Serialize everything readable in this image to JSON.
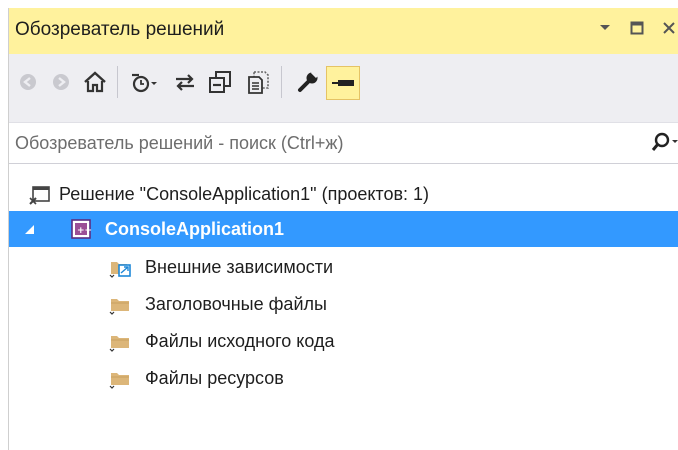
{
  "panel": {
    "title": "Обозреватель решений"
  },
  "window_buttons": {
    "dropdown_icon": "chevron-down-icon",
    "maximize_icon": "maximize-icon",
    "close_icon": "close-icon"
  },
  "toolbar": {
    "buttons": [
      {
        "name": "back",
        "icon": "back-arrow-icon"
      },
      {
        "name": "forward",
        "icon": "forward-arrow-icon"
      },
      {
        "name": "home",
        "icon": "home-icon"
      },
      {
        "name": "pending-changes",
        "icon": "clock-icon"
      },
      {
        "name": "sync",
        "icon": "sync-arrows-icon"
      },
      {
        "name": "collapse-all",
        "icon": "collapse-all-icon"
      },
      {
        "name": "show-all-files",
        "icon": "show-all-files-icon"
      },
      {
        "name": "properties",
        "icon": "wrench-icon"
      },
      {
        "name": "preview",
        "icon": "preview-pin-icon"
      }
    ]
  },
  "search": {
    "placeholder": "Обозреватель решений - поиск (Ctrl+ж)",
    "icon": "search-icon"
  },
  "tree": {
    "solution": {
      "label": "Решение \"ConsoleApplication1\"  (проектов: 1)",
      "icon": "solution-icon"
    },
    "project": {
      "label": "ConsoleApplication1",
      "icon": "cpp-project-icon",
      "selected": true,
      "expanded": true
    },
    "folders": [
      {
        "label": "Внешние зависимости",
        "icon": "external-dependencies-icon"
      },
      {
        "label": "Заголовочные файлы",
        "icon": "folder-filter-icon"
      },
      {
        "label": "Файлы исходного кода",
        "icon": "folder-filter-icon"
      },
      {
        "label": "Файлы ресурсов",
        "icon": "folder-filter-icon"
      }
    ]
  },
  "colors": {
    "title_bar": "#fff29d",
    "toolbar_bg": "#eeeef2",
    "selection": "#3399ff",
    "folder_yellow": "#dcb679"
  }
}
